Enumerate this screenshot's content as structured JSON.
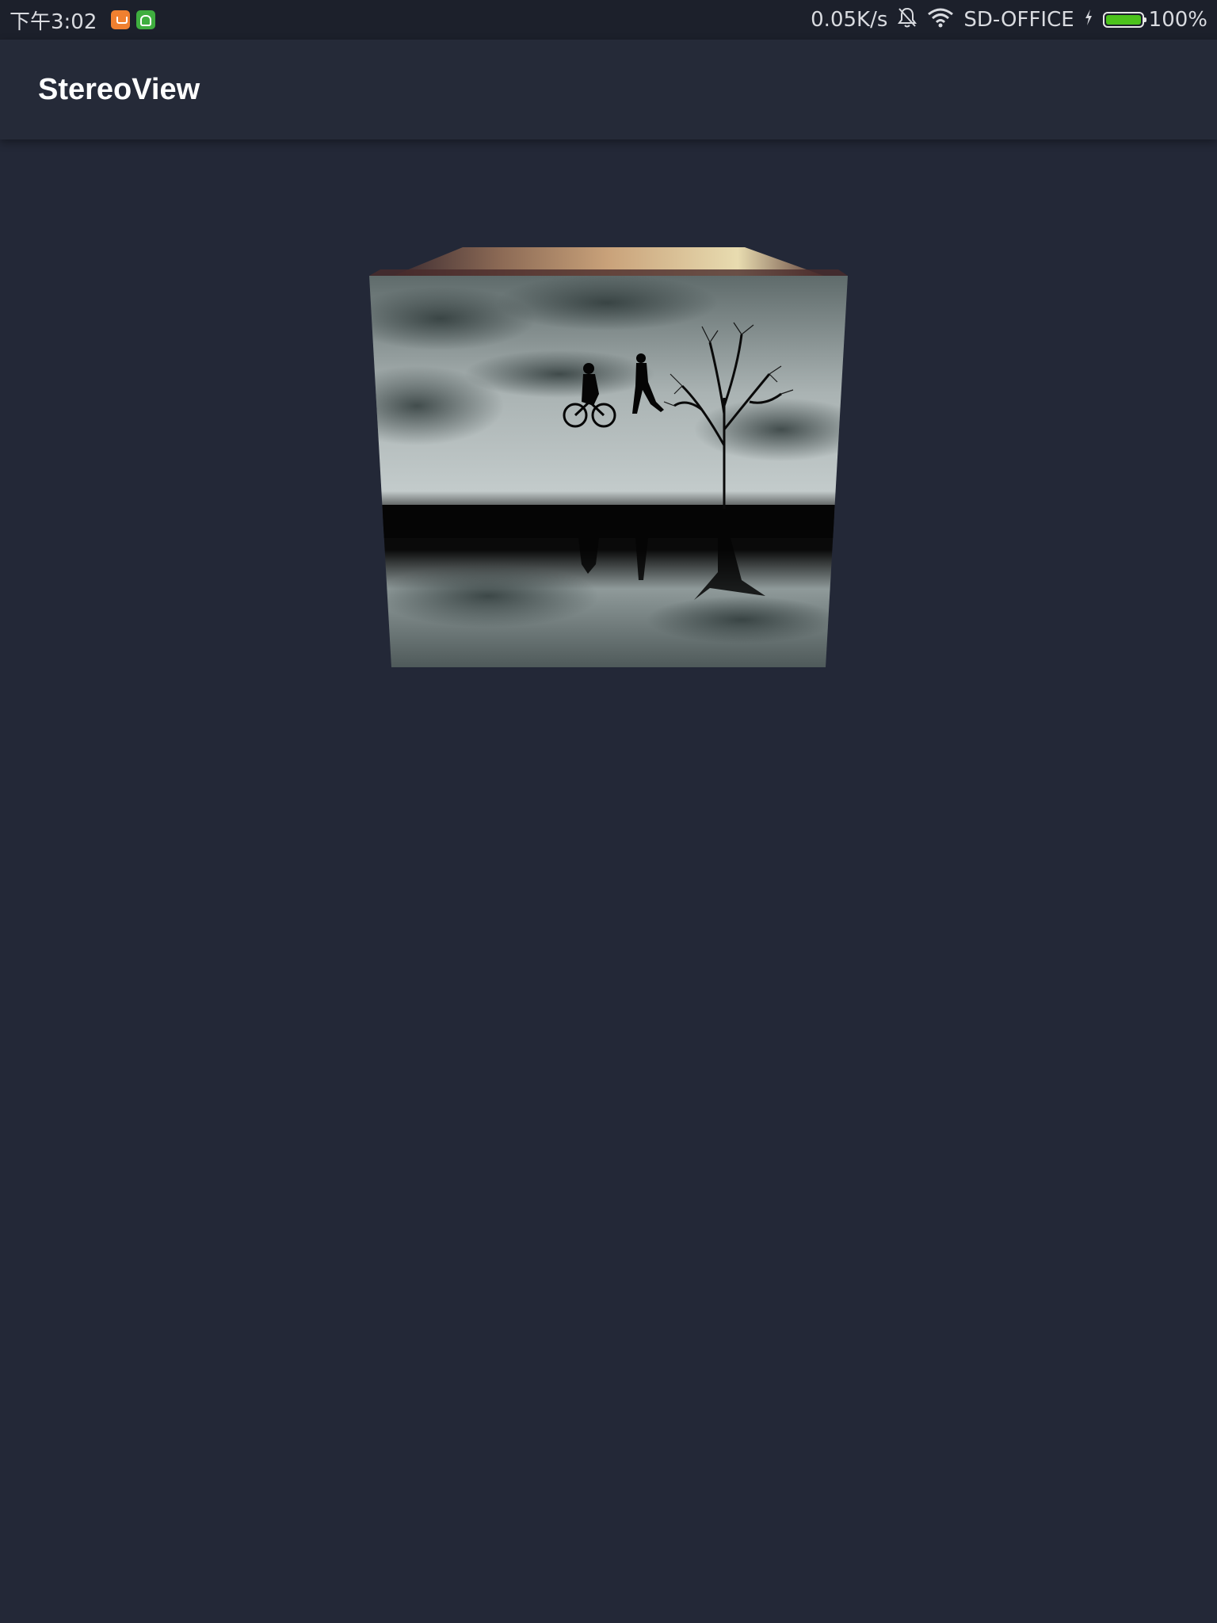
{
  "status_bar": {
    "time": "下午3:02",
    "network_speed": "0.05K/s",
    "network_name": "SD-OFFICE",
    "battery_percent_text": "100%",
    "battery_level": 1.0,
    "battery_color": "#4cc21c",
    "notification_icons": [
      "mi-store-icon",
      "android-robot-icon"
    ],
    "system_icons": [
      "bell-muted-icon",
      "wifi-icon",
      "charging-bolt-icon",
      "battery-icon"
    ]
  },
  "app_bar": {
    "title": "StereoView"
  },
  "stereo_view": {
    "front_face": "silhouette-landscape-image",
    "top_face": "warm-toned-photo-image"
  },
  "colors": {
    "background": "#232837",
    "status_bar_bg": "#1c202b",
    "app_bar_bg": "#252a38",
    "title_text": "#ffffff"
  }
}
